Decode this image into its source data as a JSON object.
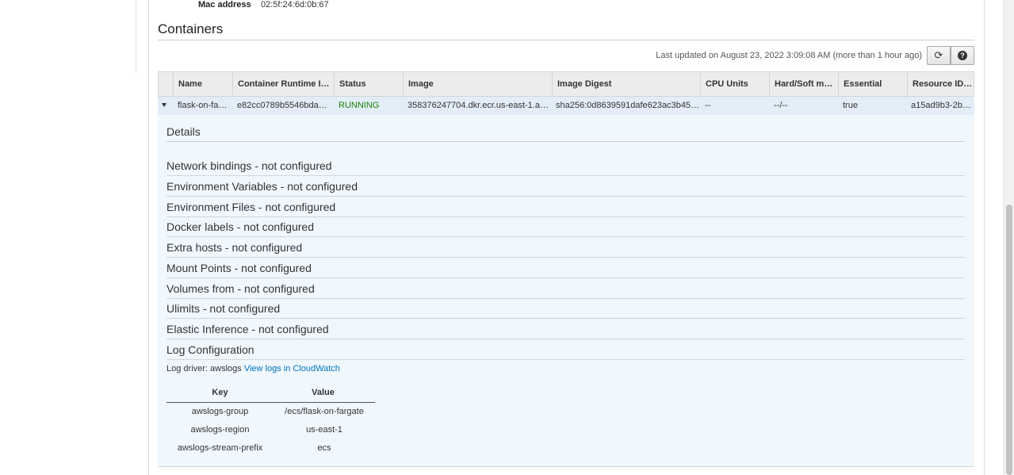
{
  "instance": {
    "mac_label": "Mac address",
    "mac_value": "02:5f:24:6d:0b:67"
  },
  "containers": {
    "title": "Containers",
    "last_updated": "Last updated on August 23, 2022 3:09:08 AM (more than 1 hour ago)",
    "refresh_icon": "refresh-icon",
    "help_icon": "help-icon",
    "help_glyph": "?",
    "refresh_glyph": "⟳",
    "columns": [
      "Name",
      "Container Runtime I…",
      "Status",
      "Image",
      "Image Digest",
      "CPU Units",
      "Hard/Soft m…",
      "Essential",
      "Resource ID…"
    ],
    "row": {
      "name": "flask-on-fa…",
      "runtime_id": "e82cc0789b5546bda…",
      "status": "RUNNING",
      "image": "358376247704.dkr.ecr.us-east-1.a…",
      "image_digest": "sha256:0d8639591dafe623ac3b45…",
      "cpu_units": "--",
      "memory": "--/--",
      "essential": "true",
      "resource_id": "a15ad9b3-2b…"
    }
  },
  "details": {
    "title": "Details",
    "sections": [
      "Network bindings - not configured",
      "Environment Variables - not configured",
      "Environment Files - not configured",
      "Docker labels - not configured",
      "Extra hosts - not configured",
      "Mount Points - not configured",
      "Volumes from - not configured",
      "Ulimits - not configured",
      "Elastic Inference - not configured",
      "Log Configuration"
    ],
    "log_driver_label": "Log driver: awslogs",
    "log_link": "View logs in CloudWatch",
    "log_table": {
      "key_header": "Key",
      "value_header": "Value",
      "rows": [
        {
          "key": "awslogs-group",
          "value": "/ecs/flask-on-fargate"
        },
        {
          "key": "awslogs-region",
          "value": "us-east-1"
        },
        {
          "key": "awslogs-stream-prefix",
          "value": "ecs"
        }
      ]
    }
  },
  "colors": {
    "running": "#1d8102",
    "link": "#0073bb",
    "row_highlight": "#e3edf7",
    "panel_bg": "#f0f7fd"
  }
}
